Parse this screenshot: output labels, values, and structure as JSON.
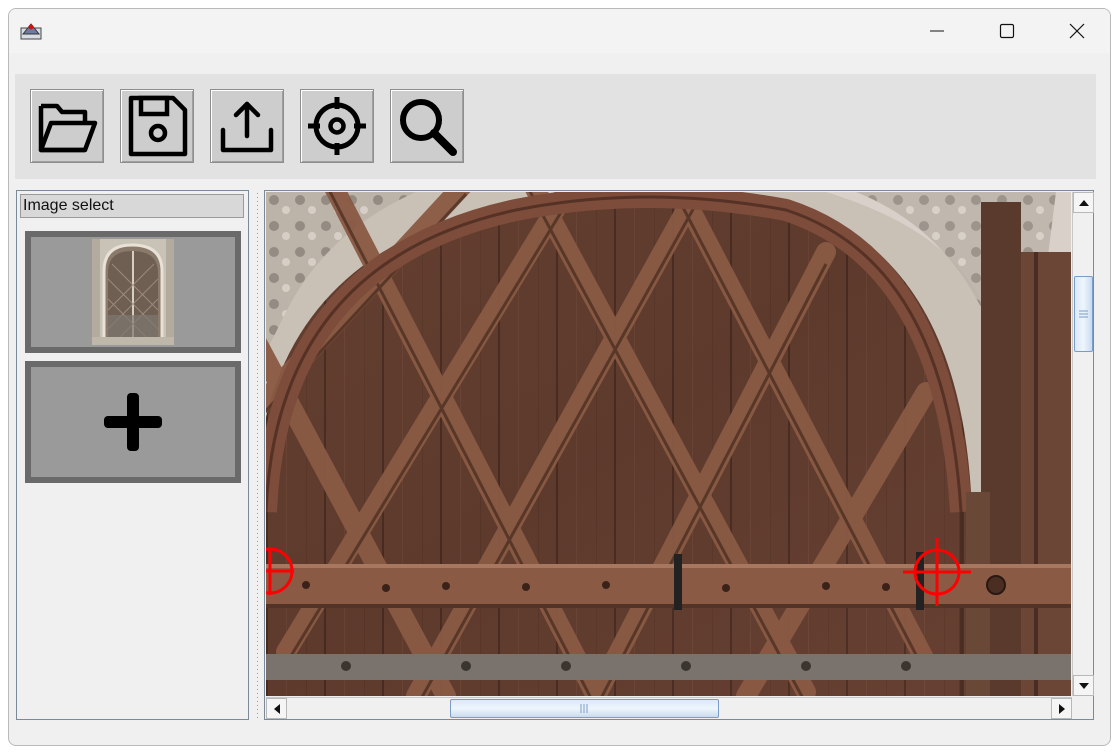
{
  "window": {
    "title": "",
    "controls": [
      "minimize-icon",
      "maximize-icon",
      "close-icon"
    ]
  },
  "toolbar": {
    "buttons": [
      {
        "name": "open",
        "icon": "folder-open-icon"
      },
      {
        "name": "save",
        "icon": "floppy-disk-icon"
      },
      {
        "name": "export",
        "icon": "upload-icon"
      },
      {
        "name": "target",
        "icon": "crosshair-icon"
      },
      {
        "name": "zoom",
        "icon": "magnifier-icon"
      }
    ]
  },
  "image_panel": {
    "title": "Image select",
    "items": [
      {
        "type": "thumbnail",
        "icon": "door-thumbnail-image"
      },
      {
        "type": "add",
        "icon": "plus-icon"
      }
    ]
  },
  "viewer": {
    "content": "photo-of-wooden-door",
    "markers": [
      "crosshair-marker-icon",
      "crosshair-marker-icon"
    ],
    "marker_color": "#ff0000"
  },
  "colors": {
    "window_bg": "#f0f0f0",
    "toolbar_bg": "#e2e2e2",
    "scroll_accent": "#7a9cc8"
  }
}
